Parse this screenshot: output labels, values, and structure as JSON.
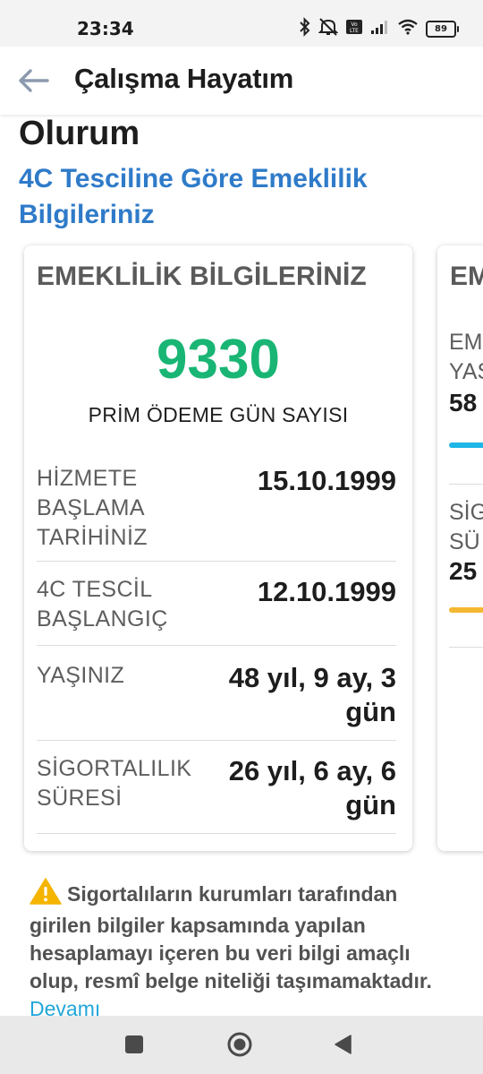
{
  "status_bar": {
    "time": "23:34",
    "battery": "89"
  },
  "header": {
    "title": "Çalışma Hayatım"
  },
  "content": {
    "partial_heading": "Olurum",
    "section_title": "4C Tesciline Göre Emeklilik Bilgileriniz"
  },
  "card": {
    "title": "EMEKLİLİK BİLGİLERİNİZ",
    "prim_days": "9330",
    "prim_label": "PRİM ÖDEME GÜN SAYISI",
    "rows": [
      {
        "label": "HİZMETE BAŞLAMA TARİHİNİZ",
        "value": "15.10.1999"
      },
      {
        "label": "4C TESCİL BAŞLANGIÇ",
        "value": "12.10.1999"
      },
      {
        "label": "YAŞINIZ",
        "value": "48 yıl, 9 ay, 3 gün"
      },
      {
        "label": "SİGORTALILIK SÜRESİ",
        "value": "26 yıl, 6 ay, 6 gün"
      }
    ]
  },
  "next_card": {
    "title": "EM",
    "label1": "EM YAŞ",
    "value1": "58",
    "label2": "SİG SÜ",
    "value2": "25",
    "bar1_color": "#1fb6e8",
    "bar2_color": "#f5b731"
  },
  "disclaimer": {
    "text": "Sigortalıların kurumları tarafından girilen bilgiler kapsamında yapılan hesaplamayı içeren bu veri bilgi amaçlı olup, resmî belge niteliği taşımamaktadır.",
    "link": "Devamı"
  },
  "colors": {
    "accent_blue": "#2f7bc9",
    "number_green": "#19b574",
    "link_cyan": "#21a6d9",
    "warning_yellow": "#f4b400"
  }
}
